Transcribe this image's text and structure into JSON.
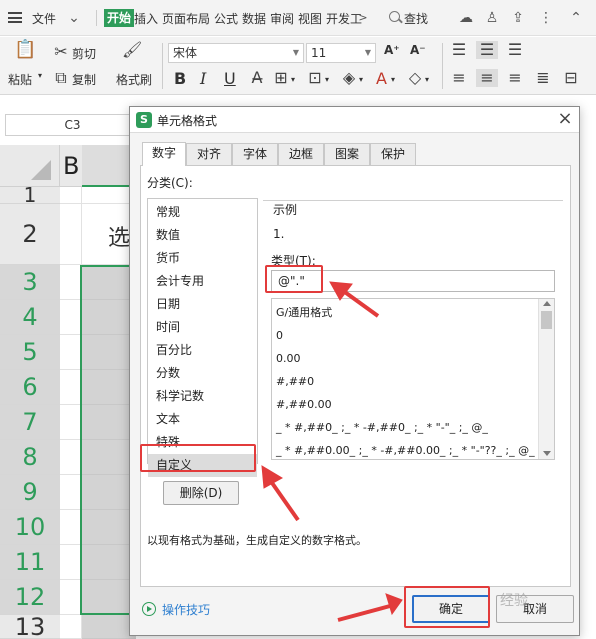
{
  "menubar": {
    "file": "文件",
    "tabs": [
      "开始",
      "插入",
      "页面布局",
      "公式",
      "数据",
      "审阅",
      "视图",
      "开发工"
    ],
    "more": ">",
    "search": "查找"
  },
  "ribbon": {
    "paste": "粘贴",
    "cut": "剪切",
    "copy": "复制",
    "format_painter": "格式刷",
    "font_name": "宋体",
    "font_size": "11",
    "bold": "B",
    "italic": "I",
    "underline": "U",
    "font_color_letter": "A",
    "grow_font": "A⁺",
    "shrink_font": "A⁻"
  },
  "formula_bar": {
    "name_box": "C3"
  },
  "sheet": {
    "col_b": "B",
    "row_numbers": [
      "1",
      "2",
      "3",
      "4",
      "5",
      "6",
      "7",
      "8",
      "9",
      "10",
      "11",
      "12",
      "13"
    ],
    "c2_text": "选"
  },
  "dialog": {
    "title": "单元格格式",
    "close": "×",
    "logo_letter": "S",
    "tabs": [
      "数字",
      "对齐",
      "字体",
      "边框",
      "图案",
      "保护"
    ],
    "category_label": "分类(C):",
    "categories": [
      "常规",
      "数值",
      "货币",
      "会计专用",
      "日期",
      "时间",
      "百分比",
      "分数",
      "科学记数",
      "文本",
      "特殊",
      "自定义"
    ],
    "selected_category": "自定义",
    "sample_label": "示例",
    "sample_value": "1.",
    "type_label": "类型(T):",
    "type_value": "@\".\"",
    "formats": [
      "G/通用格式",
      "0",
      "0.00",
      "#,##0",
      "#,##0.00",
      "_ * #,##0_ ;_ * -#,##0_ ;_ * \"-\"_ ;_ @_",
      "_ * #,##0.00_ ;_ * -#,##0.00_ ;_ * \"-\"??_ ;_ @_"
    ],
    "delete_button": "删除(D)",
    "description": "以现有格式为基础，生成自定义的数字格式。",
    "tips": "操作技巧",
    "ok_button": "确定",
    "cancel_button": "取消"
  },
  "watermark": "经验"
}
